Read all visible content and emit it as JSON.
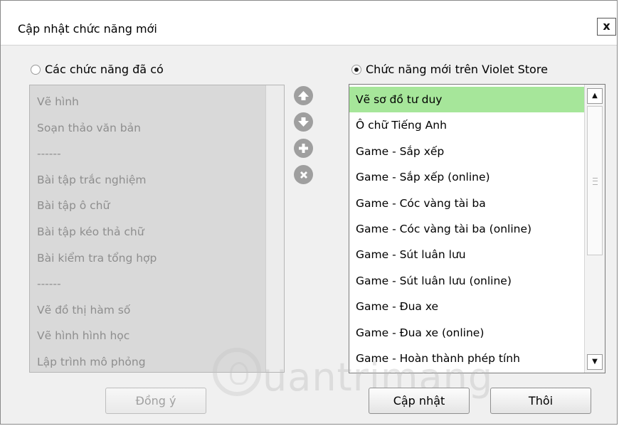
{
  "window": {
    "title": "Cập nhật chức năng mới",
    "close_label": "x"
  },
  "left_panel": {
    "radio_label": "Các chức năng đã có",
    "radio_checked": false,
    "items": [
      "Vẽ hình",
      "Soạn thảo văn bản",
      "------",
      "Bài tập trắc nghiệm",
      "Bài tập ô chữ",
      "Bài tập kéo thả chữ",
      "Bài kiểm tra tổng hợp",
      "------",
      "Vẽ đồ thị hàm số",
      "Vẽ hình hình học",
      "Lập trình mô phỏng"
    ]
  },
  "right_panel": {
    "radio_label": "Chức năng mới trên Violet Store",
    "radio_checked": true,
    "selected_index": 0,
    "items": [
      "Vẽ sơ đồ tư duy",
      "Ô chữ Tiếng Anh",
      "Game - Sắp xếp",
      "Game - Sắp xếp (online)",
      "Game - Cóc vàng tài ba",
      "Game - Cóc vàng tài ba (online)",
      "Game - Sút luân lưu",
      "Game - Sút luân lưu (online)",
      "Game - Đua xe",
      "Game - Đua xe (online)",
      "Game - Hoàn thành phép tính"
    ]
  },
  "side_buttons": {
    "icons": [
      "arrow-up-icon",
      "arrow-down-icon",
      "plus-icon",
      "x-icon"
    ]
  },
  "buttons": {
    "agree": "Đồng ý",
    "update": "Cập nhật",
    "cancel": "Thôi"
  },
  "watermark": {
    "text": "uantrimang"
  },
  "colors": {
    "selected_row": "#a6e69a",
    "left_list_bg": "#d9d9d9",
    "disabled_text": "#8e8e8e"
  }
}
